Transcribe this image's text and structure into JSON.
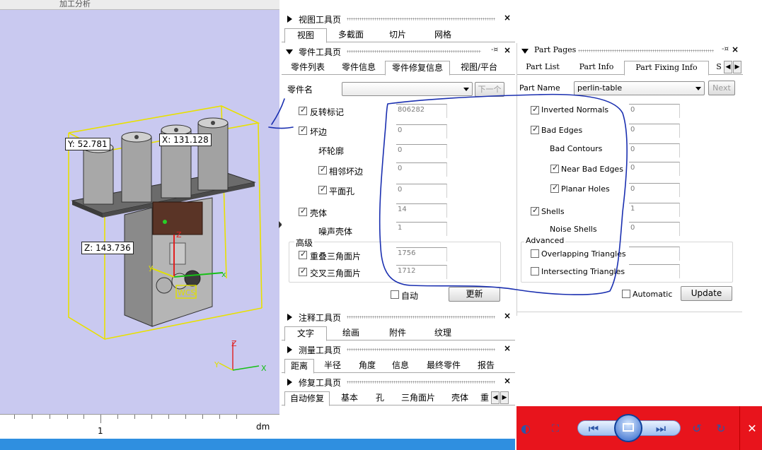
{
  "viewport": {
    "top_strip_text": "加工分析",
    "coords": {
      "y": "Y: 52.781",
      "x": "X: 131.128",
      "z": "Z: 143.736"
    },
    "wcs_label": "WCS",
    "axis_labels": {
      "z": "Z",
      "y": "y",
      "x": "x"
    },
    "triad_labels": {
      "z": "Z",
      "y": "Y",
      "x": "X"
    },
    "ruler": {
      "tick_label": "1",
      "unit": "dm"
    }
  },
  "view_toolpage": {
    "title": "视图工具页",
    "tabs": [
      "视图",
      "多截面",
      "切片",
      "网格"
    ],
    "active_tab": 0
  },
  "part_toolpage_cn": {
    "title": "零件工具页",
    "tabs": [
      "零件列表",
      "零件信息",
      "零件修复信息",
      "视图/平台"
    ],
    "active_tab": 2,
    "part_name_label": "零件名",
    "part_name_value": "",
    "next_button": "下一个",
    "rows": [
      {
        "label": "反转标记",
        "checked": true,
        "value": "806282"
      },
      {
        "label": "坏边",
        "checked": true,
        "value": "0"
      },
      {
        "label": "坏轮廓",
        "checked": null,
        "value": "0"
      },
      {
        "label": "相邻坏边",
        "checked": true,
        "value": "0"
      },
      {
        "label": "平面孔",
        "checked": true,
        "value": "0"
      },
      {
        "label": "壳体",
        "checked": true,
        "value": "14"
      },
      {
        "label": "噪声壳体",
        "checked": null,
        "value": "1"
      }
    ],
    "advanced_label": "高级",
    "advanced_rows": [
      {
        "label": "重叠三角面片",
        "checked": true,
        "value": "1756"
      },
      {
        "label": "交叉三角面片",
        "checked": true,
        "value": "1712"
      }
    ],
    "auto_label": "自动",
    "auto_checked": false,
    "update_button": "更新"
  },
  "annotation_toolpage": {
    "title": "注释工具页",
    "tabs": [
      "文字",
      "绘画",
      "附件",
      "纹理"
    ],
    "active_tab": 0
  },
  "measure_toolpage": {
    "title": "测量工具页",
    "tabs": [
      "距离",
      "半径",
      "角度",
      "信息",
      "最终零件",
      "报告"
    ],
    "active_tab": 0
  },
  "repair_toolpage": {
    "title": "修复工具页",
    "tabs": [
      "自动修复",
      "基本",
      "孔",
      "三角面片",
      "壳体",
      "重"
    ],
    "active_tab": 0
  },
  "part_pages_en": {
    "title": "Part Pages",
    "tabs": [
      "Part List",
      "Part Info",
      "Part Fixing Info",
      "S"
    ],
    "active_tab": 2,
    "part_name_label": "Part Name",
    "part_name_value": "perlin-table",
    "next_button": "Next",
    "rows": [
      {
        "label": "Inverted Normals",
        "checked": true,
        "value": "0"
      },
      {
        "label": "Bad Edges",
        "checked": true,
        "value": "0"
      },
      {
        "label": "Bad Contours",
        "checked": null,
        "value": "0"
      },
      {
        "label": "Near Bad Edges",
        "checked": true,
        "value": "0"
      },
      {
        "label": "Planar Holes",
        "checked": true,
        "value": "0"
      },
      {
        "label": "Shells",
        "checked": true,
        "value": "1"
      },
      {
        "label": "Noise Shells",
        "checked": null,
        "value": "0"
      }
    ],
    "advanced_label": "Advanced",
    "advanced_rows": [
      {
        "label": "Overlapping Triangles",
        "checked": false,
        "value": ""
      },
      {
        "label": "Intersecting Triangles",
        "checked": false,
        "value": ""
      }
    ],
    "auto_label": "Automatic",
    "auto_checked": false,
    "update_button": "Update"
  },
  "colors": {
    "viewport_bg": "#c9c9f0",
    "annotation_ink": "#1a2fb0",
    "bounding_box": "#e8e000",
    "media_bar": "#e8141c",
    "task_blue": "#2f8fe0"
  }
}
